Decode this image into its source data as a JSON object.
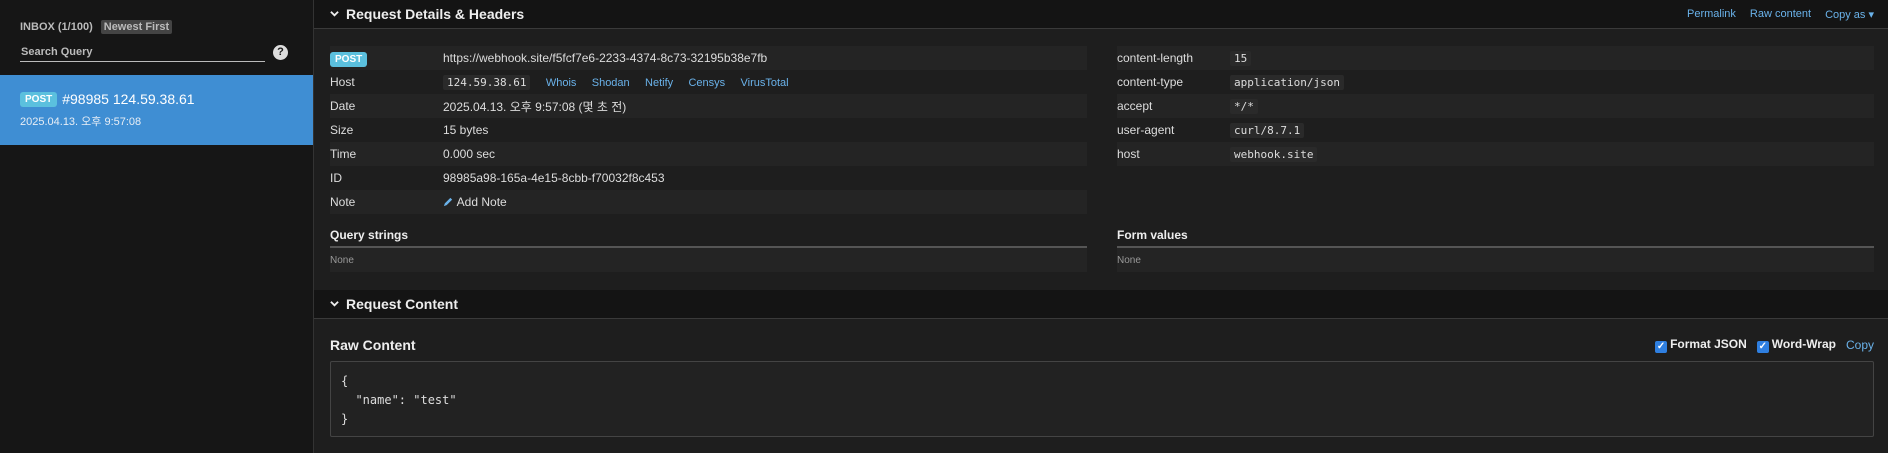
{
  "sidebar": {
    "inbox_label": "INBOX (1/100)",
    "sort_label": "Newest First",
    "search_placeholder": "Search Query",
    "help_icon": "?",
    "requests": [
      {
        "method": "POST",
        "id_ip": "#98985 124.59.38.61",
        "date": "2025.04.13. 오후 9:57:08"
      }
    ]
  },
  "details": {
    "title": "Request Details & Headers",
    "actions": {
      "permalink": "Permalink",
      "raw": "Raw content",
      "copy_as": "Copy as ▾"
    },
    "method": "POST",
    "url": "https://webhook.site/f5fcf7e6-2233-4374-8c73-32195b38e7fb",
    "host_label": "Host",
    "host": "124.59.38.61",
    "host_links": [
      "Whois",
      "Shodan",
      "Netify",
      "Censys",
      "VirusTotal"
    ],
    "date_label": "Date",
    "date": "2025.04.13. 오후 9:57:08 (몇 초 전)",
    "size_label": "Size",
    "size": "15 bytes",
    "time_label": "Time",
    "time": "0.000 sec",
    "id_label": "ID",
    "id": "98985a98-165a-4e15-8cbb-f70032f8c453",
    "note_label": "Note",
    "add_note": "Add Note",
    "headers": [
      {
        "k": "content-length",
        "v": "15"
      },
      {
        "k": "content-type",
        "v": "application/json"
      },
      {
        "k": "accept",
        "v": "*/*"
      },
      {
        "k": "user-agent",
        "v": "curl/8.7.1"
      },
      {
        "k": "host",
        "v": "webhook.site"
      }
    ],
    "query_title": "Query strings",
    "query_value": "None",
    "form_title": "Form values",
    "form_value": "None"
  },
  "content": {
    "title": "Request Content",
    "raw_title": "Raw Content",
    "format_json": "Format JSON",
    "word_wrap": "Word-Wrap",
    "copy": "Copy",
    "body": "{\n  \"name\": \"test\"\n}"
  },
  "colors": {
    "accent": "#3f8ed3",
    "link": "#6ab2ea",
    "badge": "#5bc0de"
  }
}
